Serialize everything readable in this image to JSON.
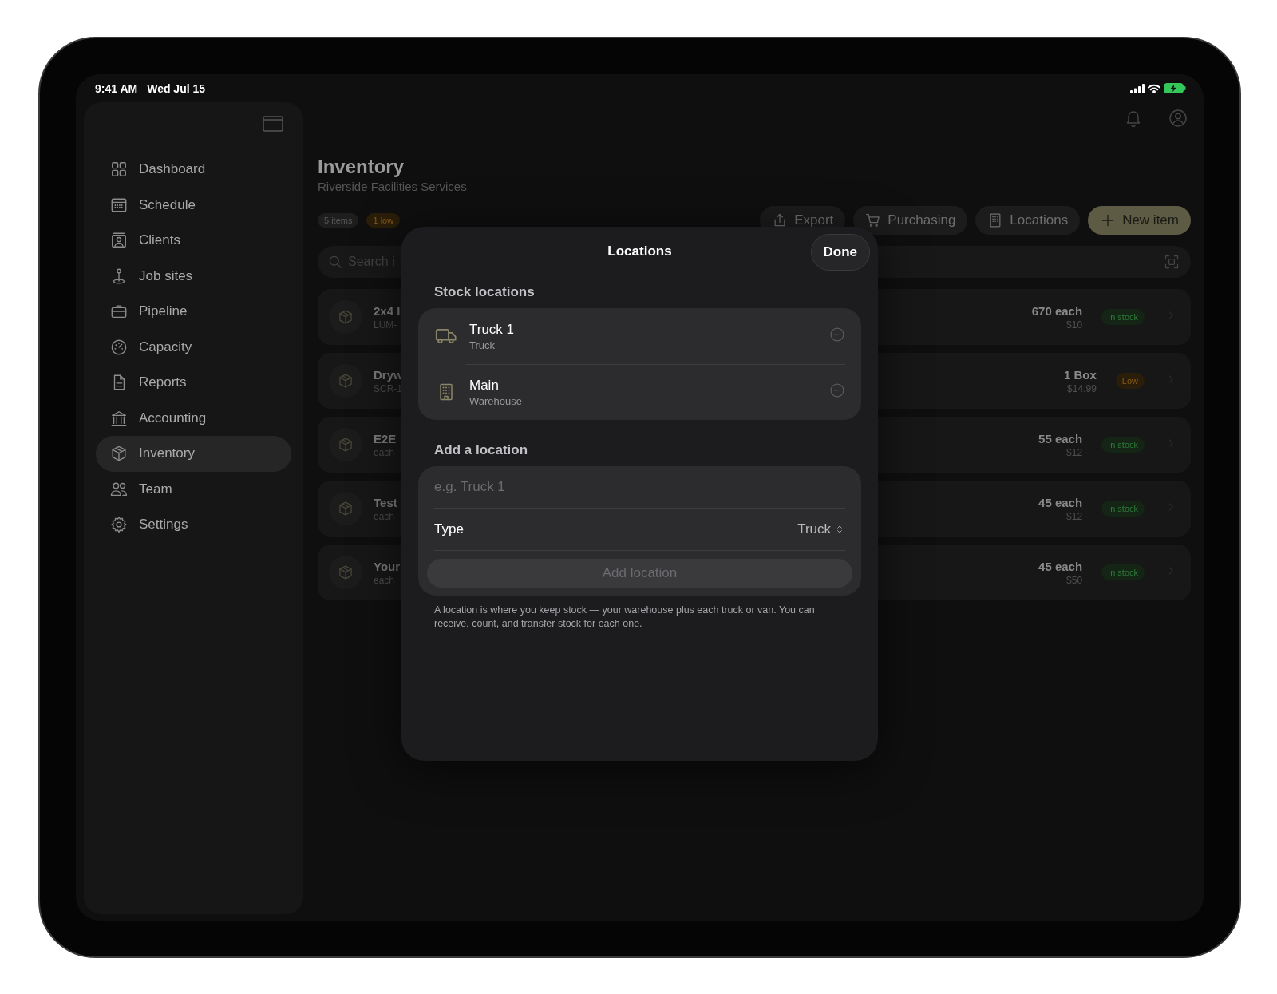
{
  "status_bar": {
    "time": "9:41 AM",
    "date": "Wed Jul 15"
  },
  "sidebar": {
    "items": [
      {
        "label": "Dashboard",
        "selected": false
      },
      {
        "label": "Schedule",
        "selected": false
      },
      {
        "label": "Clients",
        "selected": false
      },
      {
        "label": "Job sites",
        "selected": false
      },
      {
        "label": "Pipeline",
        "selected": false
      },
      {
        "label": "Capacity",
        "selected": false
      },
      {
        "label": "Reports",
        "selected": false
      },
      {
        "label": "Accounting",
        "selected": false
      },
      {
        "label": "Inventory",
        "selected": true
      },
      {
        "label": "Team",
        "selected": false
      },
      {
        "label": "Settings",
        "selected": false
      }
    ]
  },
  "header": {
    "title": "Inventory",
    "subtitle": "Riverside Facilities Services"
  },
  "badges": [
    {
      "text": "5 items",
      "kind": "neutral"
    },
    {
      "text": "1 low",
      "kind": "warning"
    }
  ],
  "actions": [
    {
      "label": "Export",
      "kind": "secondary"
    },
    {
      "label": "Purchasing",
      "kind": "secondary"
    },
    {
      "label": "Locations",
      "kind": "secondary"
    },
    {
      "label": "New item",
      "kind": "primary"
    }
  ],
  "search": {
    "placeholder": "Search i"
  },
  "items": [
    {
      "name": "2x4 I",
      "detail": "LUM-",
      "quantity": "670 each",
      "price": "$10",
      "status": {
        "label": "In stock",
        "kind": "ok"
      }
    },
    {
      "name": "Dryw",
      "detail": "SCR-1",
      "quantity": "1 Box",
      "price": "$14.99",
      "status": {
        "label": "Low",
        "kind": "low"
      }
    },
    {
      "name": "E2E",
      "detail": "each",
      "quantity": "55 each",
      "price": "$12",
      "status": {
        "label": "In stock",
        "kind": "ok"
      }
    },
    {
      "name": "Test",
      "detail": "each",
      "quantity": "45 each",
      "price": "$12",
      "status": {
        "label": "In stock",
        "kind": "ok"
      }
    },
    {
      "name": "Your",
      "detail": "each",
      "quantity": "45 each",
      "price": "$50",
      "status": {
        "label": "In stock",
        "kind": "ok"
      }
    }
  ],
  "modal": {
    "title": "Locations",
    "done": "Done",
    "stock_locations": {
      "title": "Stock locations",
      "items": [
        {
          "name": "Truck 1",
          "type": "Truck",
          "kind": "truck"
        },
        {
          "name": "Main",
          "type": "Warehouse",
          "kind": "warehouse"
        }
      ]
    },
    "add_form": {
      "title": "Add a location",
      "placeholder": "e.g. Truck 1",
      "type_label": "Type",
      "type_value": "Truck",
      "button": {
        "label": "Add location",
        "disabled": true
      }
    },
    "footnote": "A location is where you keep stock — your warehouse plus each truck or van. You can receive, count, and transfer stock for each one."
  }
}
